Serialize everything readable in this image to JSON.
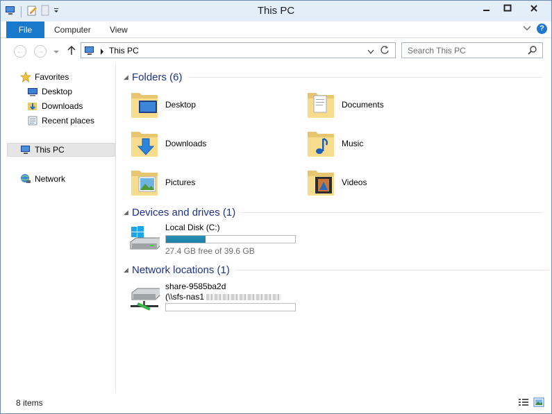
{
  "window": {
    "title": "This PC"
  },
  "ribbon": {
    "tabs": [
      "File",
      "Computer",
      "View"
    ]
  },
  "address": {
    "path": "This PC"
  },
  "search": {
    "placeholder": "Search This PC"
  },
  "sidebar": {
    "favorites_label": "Favorites",
    "favorites": [
      "Desktop",
      "Downloads",
      "Recent places"
    ],
    "this_pc": "This PC",
    "network": "Network"
  },
  "groups": {
    "folders_title": "Folders (6)",
    "drives_title": "Devices and drives (1)",
    "network_title": "Network locations (1)"
  },
  "folders": [
    {
      "name": "Desktop",
      "icon": "desktop-folder-icon"
    },
    {
      "name": "Documents",
      "icon": "documents-folder-icon"
    },
    {
      "name": "Downloads",
      "icon": "downloads-folder-icon"
    },
    {
      "name": "Music",
      "icon": "music-folder-icon"
    },
    {
      "name": "Pictures",
      "icon": "pictures-folder-icon"
    },
    {
      "name": "Videos",
      "icon": "videos-folder-icon"
    }
  ],
  "drive": {
    "name": "Local Disk (C:)",
    "space": "27.4 GB free of 39.6 GB",
    "used_fraction": 0.308
  },
  "network_location": {
    "line1": "share-9585ba2d",
    "line2": "(\\\\sfs-nas1"
  },
  "status": {
    "item_count": "8 items"
  },
  "colors": {
    "accent": "#1979ca",
    "group_title": "#1e3287",
    "bar_fill": "#1c7fa6"
  }
}
